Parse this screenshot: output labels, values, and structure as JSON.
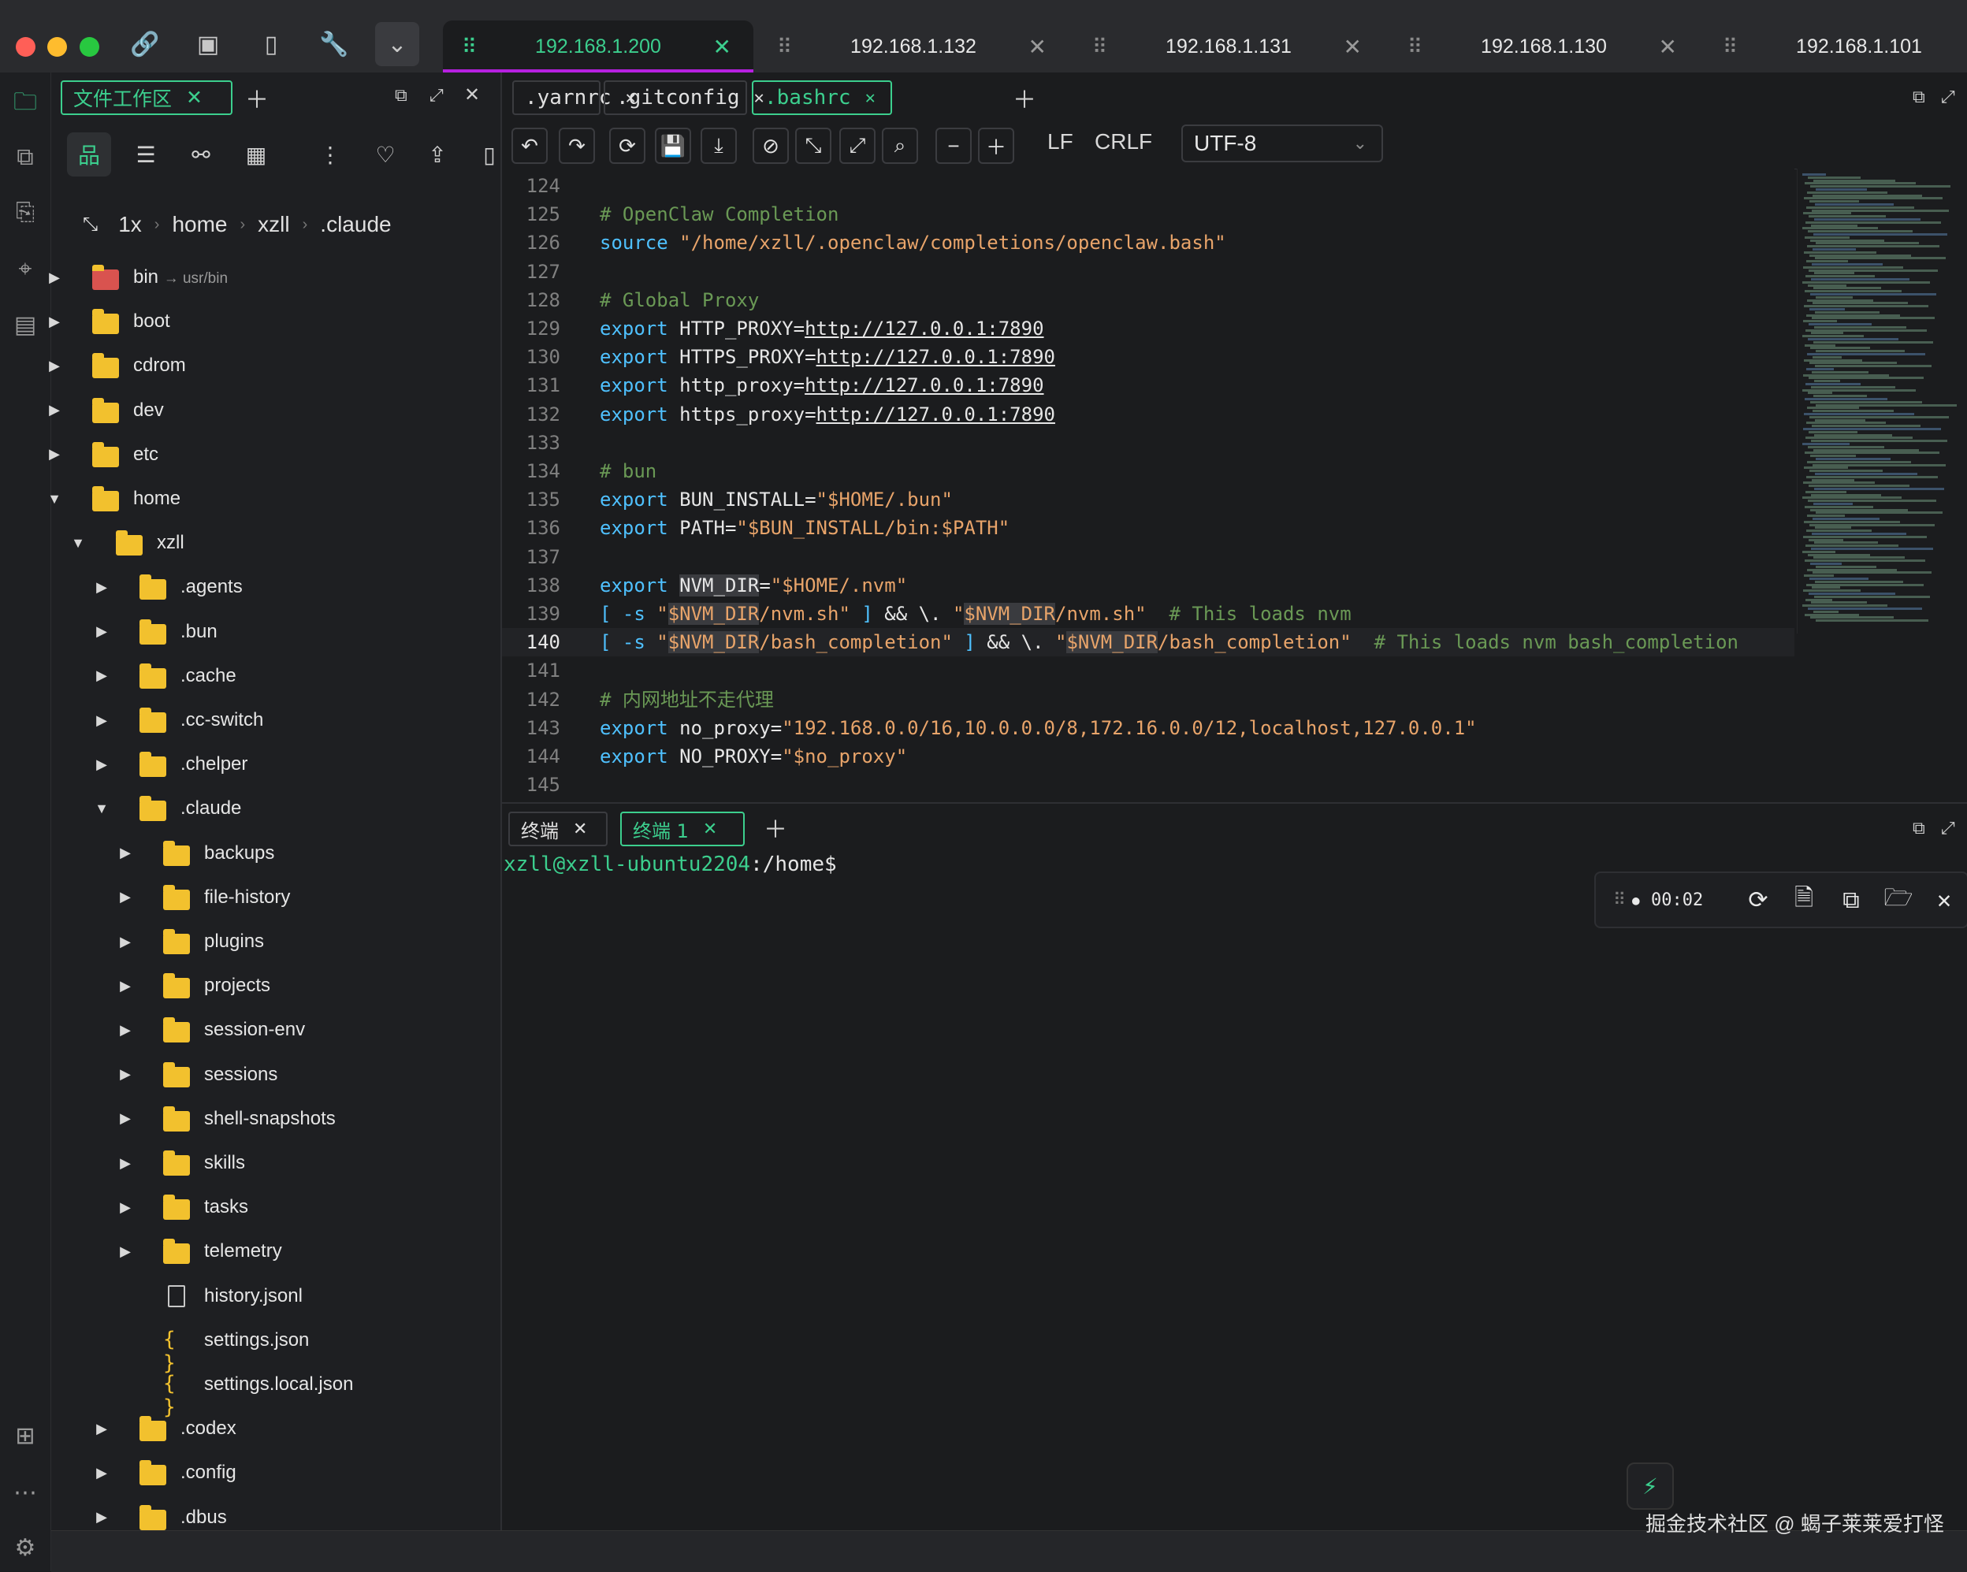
{
  "colors": {
    "accent": "#3ccf8e",
    "tab_indicator": "#b620e0",
    "folder": "#f2c12e",
    "keyword": "#4fc1ff",
    "string": "#e8a46a",
    "comment": "#6a9955"
  },
  "host_tabs": [
    {
      "label": "192.168.1.200",
      "active": true
    },
    {
      "label": "192.168.1.132",
      "active": false
    },
    {
      "label": "192.168.1.131",
      "active": false
    },
    {
      "label": "192.168.1.130",
      "active": false
    },
    {
      "label": "192.168.1.101",
      "active": false
    }
  ],
  "file_panel": {
    "tab_label": "文件工作区",
    "zoom": "1x",
    "breadcrumb": [
      "home",
      "xzll",
      ".claude"
    ],
    "tree": [
      {
        "name": "bin",
        "link": "→ usr/bin",
        "type": "link"
      },
      {
        "name": "boot",
        "type": "folder"
      },
      {
        "name": "cdrom",
        "type": "folder"
      },
      {
        "name": "dev",
        "type": "folder"
      },
      {
        "name": "etc",
        "type": "folder"
      },
      {
        "name": "home",
        "type": "folder",
        "open": true
      },
      {
        "name": "xzll",
        "type": "folder",
        "open": true
      },
      {
        "name": ".agents",
        "type": "folder"
      },
      {
        "name": ".bun",
        "type": "folder"
      },
      {
        "name": ".cache",
        "type": "folder"
      },
      {
        "name": ".cc-switch",
        "type": "folder"
      },
      {
        "name": ".chelper",
        "type": "folder"
      },
      {
        "name": ".claude",
        "type": "folder",
        "open": true
      },
      {
        "name": "backups",
        "type": "folder"
      },
      {
        "name": "file-history",
        "type": "folder"
      },
      {
        "name": "plugins",
        "type": "folder"
      },
      {
        "name": "projects",
        "type": "folder"
      },
      {
        "name": "session-env",
        "type": "folder"
      },
      {
        "name": "sessions",
        "type": "folder"
      },
      {
        "name": "shell-snapshots",
        "type": "folder"
      },
      {
        "name": "skills",
        "type": "folder"
      },
      {
        "name": "tasks",
        "type": "folder"
      },
      {
        "name": "telemetry",
        "type": "folder"
      },
      {
        "name": "history.jsonl",
        "type": "file"
      },
      {
        "name": "settings.json",
        "type": "json"
      },
      {
        "name": "settings.local.json",
        "type": "json"
      },
      {
        "name": ".codex",
        "type": "folder"
      },
      {
        "name": ".config",
        "type": "folder"
      },
      {
        "name": ".dbus",
        "type": "folder"
      }
    ]
  },
  "editor": {
    "tabs": [
      {
        "label": ".yarnrc",
        "active": false
      },
      {
        "label": ".gitconfig",
        "active": false
      },
      {
        "label": ".bashrc",
        "active": true
      }
    ],
    "line_endings": [
      "LF",
      "CRLF"
    ],
    "encoding": "UTF-8",
    "lines": [
      {
        "n": "124",
        "t": ""
      },
      {
        "n": "125",
        "t": "# OpenClaw Completion"
      },
      {
        "n": "126",
        "t": "source \"/home/xzll/.openclaw/completions/openclaw.bash\""
      },
      {
        "n": "127",
        "t": ""
      },
      {
        "n": "128",
        "t": "# Global Proxy"
      },
      {
        "n": "129",
        "t": "export HTTP_PROXY=http://127.0.0.1:7890"
      },
      {
        "n": "130",
        "t": "export HTTPS_PROXY=http://127.0.0.1:7890"
      },
      {
        "n": "131",
        "t": "export http_proxy=http://127.0.0.1:7890"
      },
      {
        "n": "132",
        "t": "export https_proxy=http://127.0.0.1:7890"
      },
      {
        "n": "133",
        "t": ""
      },
      {
        "n": "134",
        "t": "# bun"
      },
      {
        "n": "135",
        "t": "export BUN_INSTALL=\"$HOME/.bun\""
      },
      {
        "n": "136",
        "t": "export PATH=\"$BUN_INSTALL/bin:$PATH\""
      },
      {
        "n": "137",
        "t": ""
      },
      {
        "n": "138",
        "t": "export NVM_DIR=\"$HOME/.nvm\""
      },
      {
        "n": "139",
        "t": "[ -s \"$NVM_DIR/nvm.sh\" ] && \\. \"$NVM_DIR/nvm.sh\"  # This loads nvm"
      },
      {
        "n": "140",
        "t": "[ -s \"$NVM_DIR/bash_completion\" ] && \\. \"$NVM_DIR/bash_completion\"  # This loads nvm bash_completion"
      },
      {
        "n": "141",
        "t": ""
      },
      {
        "n": "142",
        "t": "# 内网地址不走代理"
      },
      {
        "n": "143",
        "t": "export no_proxy=\"192.168.0.0/16,10.0.0.0/8,172.16.0.0/12,localhost,127.0.0.1\""
      },
      {
        "n": "144",
        "t": "export NO_PROXY=\"$no_proxy\""
      },
      {
        "n": "145",
        "t": ""
      }
    ],
    "current_line": "140"
  },
  "terminal": {
    "tabs": [
      {
        "label": "终端",
        "active": false
      },
      {
        "label": "终端 1",
        "active": true
      }
    ],
    "prompt_user": "xzll@xzll-ubuntu2204",
    "prompt_path": ":/home",
    "prompt_symbol": "$",
    "timer": "00:02"
  },
  "watermark": "掘金技术社区 @ 蝎子莱莱爱打怪"
}
